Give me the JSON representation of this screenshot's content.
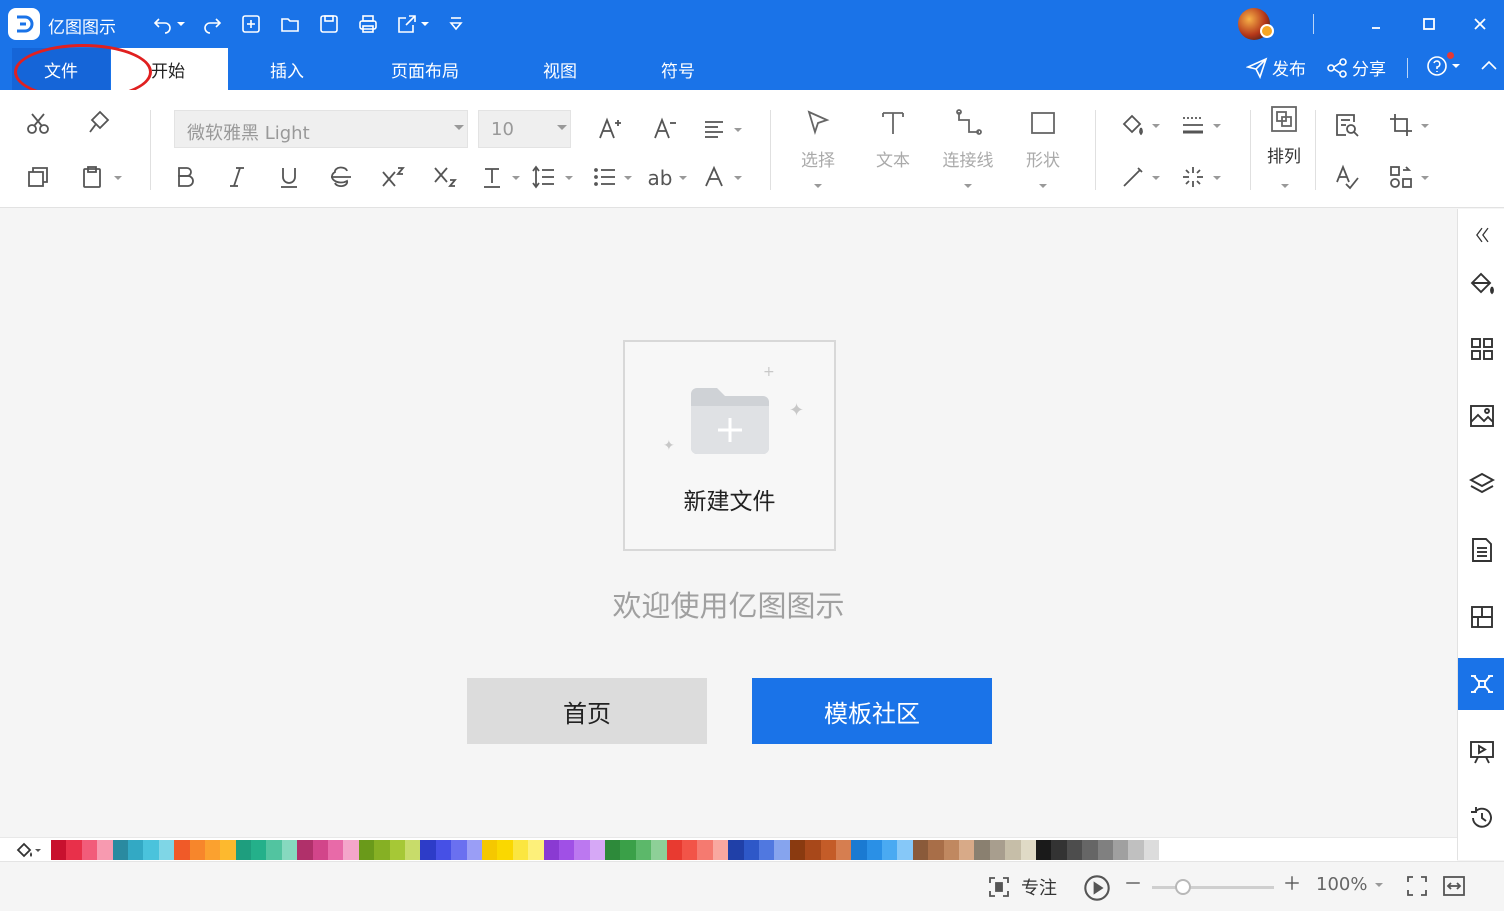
{
  "app": {
    "title": "亿图图示"
  },
  "menu": {
    "tabs": [
      "文件",
      "开始",
      "插入",
      "页面布局",
      "视图",
      "符号"
    ],
    "active_tab": "开始",
    "publish_label": "发布",
    "share_label": "分享"
  },
  "ribbon": {
    "font_name": "微软雅黑 Light",
    "font_size": "10",
    "select_label": "选择",
    "text_label": "文本",
    "connector_label": "连接线",
    "shape_label": "形状",
    "arrange_label": "排列"
  },
  "canvas": {
    "new_file_label": "新建文件",
    "welcome_text": "欢迎使用亿图图示",
    "home_button": "首页",
    "template_button": "模板社区"
  },
  "statusbar": {
    "focus_label": "专注",
    "zoom_level": "100%"
  },
  "colors": {
    "accent": "#1a73e8",
    "annotation": "#e02020",
    "palette": [
      "#c8102e",
      "#e8304a",
      "#f25c7a",
      "#f79ab0",
      "#2a8aa0",
      "#33a9c4",
      "#4ac3dc",
      "#7fd6e6",
      "#f05a28",
      "#f7862b",
      "#fba12f",
      "#fdb92e",
      "#1e9e7e",
      "#24b08a",
      "#52c4a0",
      "#86d9bf",
      "#b0306a",
      "#d2458a",
      "#e86aa8",
      "#f4a6ca",
      "#6a9a1a",
      "#86b024",
      "#a6c836",
      "#c8dc6a",
      "#2d3cc8",
      "#4650e6",
      "#6a70f0",
      "#9a9ef6",
      "#f5c800",
      "#fad800",
      "#fbe640",
      "#fdf07a",
      "#8a3ad2",
      "#a050e6",
      "#bc78f0",
      "#d6a8f6",
      "#2d8a3a",
      "#3aa048",
      "#5cb86a",
      "#8ed098",
      "#e83a30",
      "#f25448",
      "#f57a70",
      "#f9a8a0",
      "#2040a8",
      "#2e58c8",
      "#5078e0",
      "#86a4ee",
      "#8a3a10",
      "#a8481a",
      "#c45c28",
      "#d67e50",
      "#1a7ad2",
      "#2a90e6",
      "#4aaaf2",
      "#86c8f8",
      "#8a5a3a",
      "#a86e48",
      "#c08860",
      "#d8aa88",
      "#8a8070",
      "#a89e8e",
      "#c6bea8",
      "#e0dac6",
      "#1a1a1a",
      "#333333",
      "#4d4d4d",
      "#666666",
      "#808080",
      "#a0a0a0",
      "#c0c0c0",
      "#dcdcdc",
      "#ffffff"
    ]
  }
}
